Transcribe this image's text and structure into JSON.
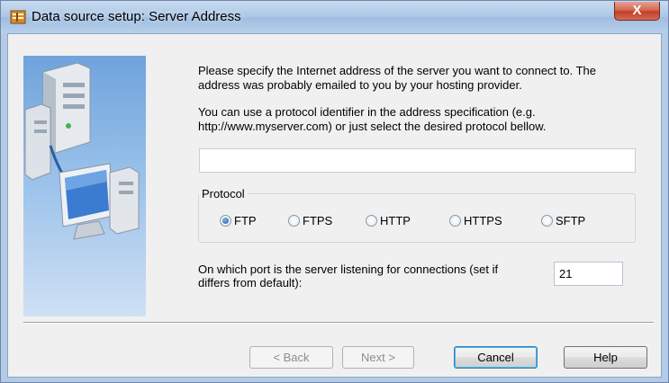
{
  "window": {
    "title": "Data source setup: Server Address",
    "close_glyph": "X"
  },
  "content": {
    "intro_text": "Please specify the Internet address of the server you want to connect to. The address was probably emailed to you by your hosting provider.",
    "protocol_hint": "You can use a protocol identifier in the address specification (e.g. http://www.myserver.com) or just select the desired protocol bellow.",
    "address_value": ""
  },
  "protocol": {
    "legend": "Protocol",
    "options": [
      {
        "label": "FTP",
        "checked": true
      },
      {
        "label": "FTPS",
        "checked": false
      },
      {
        "label": "HTTP",
        "checked": false
      },
      {
        "label": "HTTPS",
        "checked": false
      },
      {
        "label": "SFTP",
        "checked": false
      }
    ]
  },
  "port": {
    "label": "On which port is the server listening for connections (set if differs from default):",
    "value": "21"
  },
  "buttons": {
    "back": "< Back",
    "next": "Next >",
    "cancel": "Cancel",
    "help": "Help"
  },
  "icons": {
    "title_icon": "app-icon",
    "side_image": "network-servers-illustration"
  }
}
